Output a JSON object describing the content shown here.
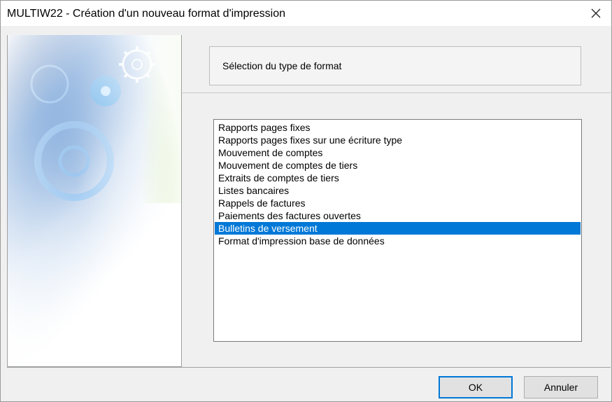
{
  "window": {
    "title": "MULTIW22 - Création d'un nouveau format d'impression",
    "close_icon": "close-icon"
  },
  "header": {
    "text": "Sélection du type de format"
  },
  "format_types": {
    "items": [
      "Rapports pages fixes",
      "Rapports pages fixes sur une écriture type",
      "Mouvement de comptes",
      "Mouvement de comptes de tiers",
      "Extraits de comptes de tiers",
      "Listes bancaires",
      "Rappels de factures",
      "Paiements des factures ouvertes",
      "Bulletins de versement",
      "Format d'impression base de données"
    ],
    "selected_index": 8
  },
  "buttons": {
    "ok_label": "OK",
    "cancel_label": "Annuler"
  },
  "colors": {
    "selection": "#0078d7",
    "wizard_accent_green": "#7ec62b",
    "wizard_blue": "#2f6fbe"
  }
}
